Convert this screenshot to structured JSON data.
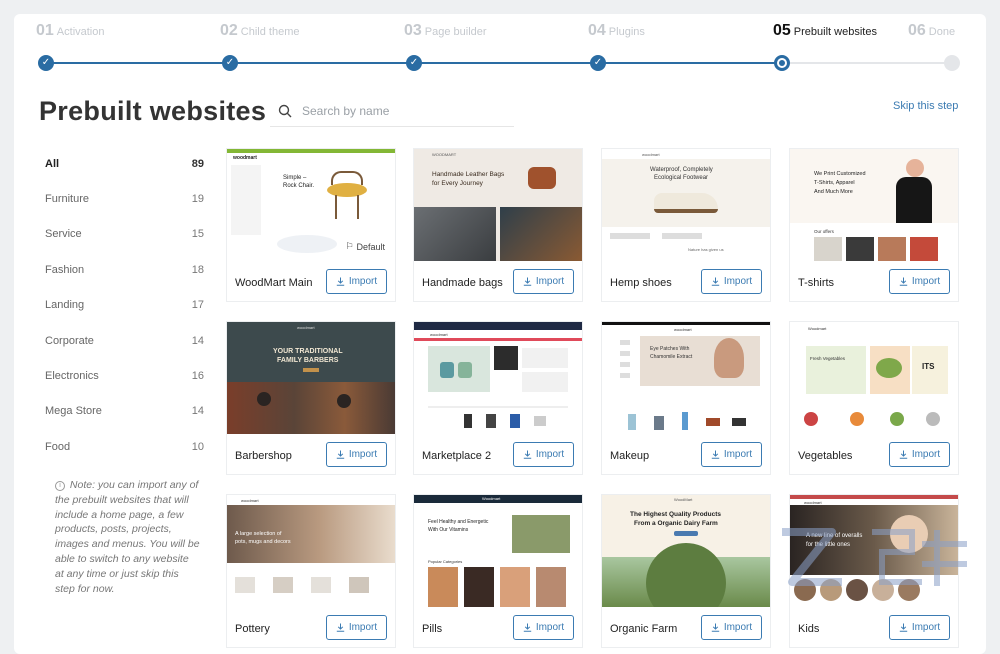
{
  "steps": [
    {
      "num": "01",
      "label": "Activation",
      "state": "done"
    },
    {
      "num": "02",
      "label": "Child theme",
      "state": "done"
    },
    {
      "num": "03",
      "label": "Page builder",
      "state": "done"
    },
    {
      "num": "04",
      "label": "Plugins",
      "state": "done"
    },
    {
      "num": "05",
      "label": "Prebuilt websites",
      "state": "current"
    },
    {
      "num": "06",
      "label": "Done",
      "state": "future"
    }
  ],
  "page": {
    "title": "Prebuilt websites",
    "search_placeholder": "Search by name",
    "skip_label": "Skip this step"
  },
  "categories": [
    {
      "name": "All",
      "count": "89",
      "active": true
    },
    {
      "name": "Furniture",
      "count": "19"
    },
    {
      "name": "Service",
      "count": "15"
    },
    {
      "name": "Fashion",
      "count": "18"
    },
    {
      "name": "Landing",
      "count": "17"
    },
    {
      "name": "Corporate",
      "count": "14"
    },
    {
      "name": "Electronics",
      "count": "16"
    },
    {
      "name": "Mega Store",
      "count": "14"
    },
    {
      "name": "Food",
      "count": "10"
    }
  ],
  "note": "Note: you can import any of the prebuilt websites that will include a home page, a few products, posts, projects, images and menus. You will be able to switch to any website at any time or just skip this step for now.",
  "import_label": "Import",
  "default_label": "Default",
  "websites": [
    {
      "name": "WoodMart Main",
      "default": true,
      "thumb_text": [
        "woodmart",
        "Simple –",
        "Rock Chair."
      ]
    },
    {
      "name": "Handmade bags",
      "thumb_text": [
        "WOODMART",
        "Handmade Leather Bags",
        "for Every Journey"
      ]
    },
    {
      "name": "Hemp shoes",
      "thumb_text": [
        "woodmart",
        "Waterproof, Completely",
        "Ecological Footwear",
        "Nature has given us"
      ]
    },
    {
      "name": "T-shirts",
      "thumb_text": [
        "We Print Customized",
        "T-Shirts, Apparel",
        "And Much More",
        "Our offers"
      ]
    },
    {
      "name": "Barbershop",
      "thumb_text": [
        "woodmart",
        "YOUR TRADITIONAL",
        "FAMILY BARBERS"
      ]
    },
    {
      "name": "Marketplace 2",
      "thumb_text": [
        "woodmart"
      ]
    },
    {
      "name": "Makeup",
      "thumb_text": [
        "woodmart",
        "Eye Patches With",
        "Chamomile Extract"
      ]
    },
    {
      "name": "Vegetables",
      "thumb_text": [
        "Woodmart",
        "Fresh Vegetables",
        "ITS"
      ]
    },
    {
      "name": "Pottery",
      "thumb_text": [
        "woodmart",
        "A large selection of",
        "pots, mugs and decors"
      ]
    },
    {
      "name": "Pills",
      "thumb_text": [
        "Woodmart",
        "Feel Healthy and Energetic",
        "With Our Vitamins",
        "Popular Categories"
      ]
    },
    {
      "name": "Organic Farm",
      "thumb_text": [
        "WoodMart",
        "The Highest Quality Products",
        "From a Organic Dairy Farm"
      ]
    },
    {
      "name": "Kids",
      "thumb_text": [
        "woodmart",
        "A new line of overalls",
        "for the little ones"
      ]
    }
  ],
  "colors": {
    "accent": "#2a6ca3",
    "link": "#3b7bb2",
    "step_inactive": "#c5c9ce"
  },
  "icons": {
    "search": "search-icon",
    "import": "download-icon",
    "default": "flag-icon",
    "note": "info-icon"
  }
}
